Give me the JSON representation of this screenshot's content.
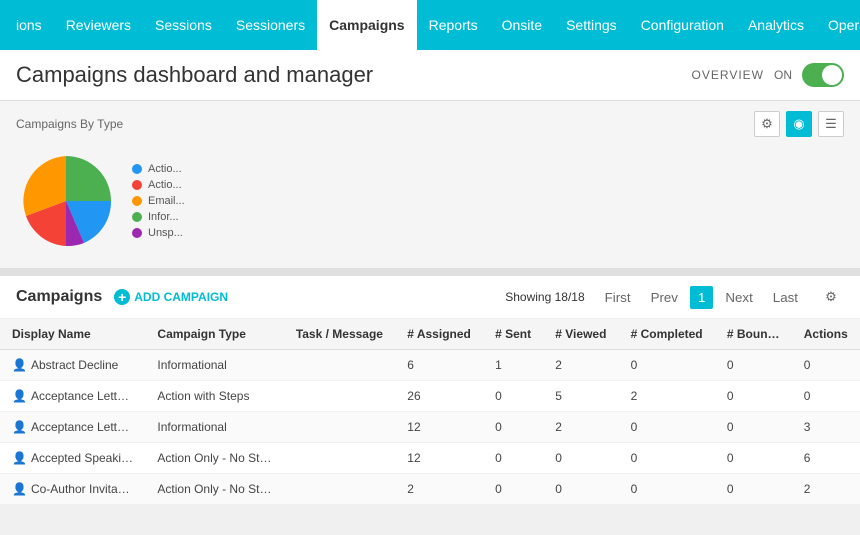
{
  "nav": {
    "items": [
      {
        "label": "ions",
        "active": false
      },
      {
        "label": "Reviewers",
        "active": false
      },
      {
        "label": "Sessions",
        "active": false
      },
      {
        "label": "Sessioners",
        "active": false
      },
      {
        "label": "Campaigns",
        "active": true
      },
      {
        "label": "Reports",
        "active": false
      },
      {
        "label": "Onsite",
        "active": false
      },
      {
        "label": "Settings",
        "active": false
      },
      {
        "label": "Configuration",
        "active": false
      },
      {
        "label": "Analytics",
        "active": false
      },
      {
        "label": "Operation",
        "active": false
      }
    ]
  },
  "header": {
    "title": "Campaigns dashboard and manager",
    "overview_label": "OVERVIEW",
    "on_label": "ON"
  },
  "chart": {
    "title": "Campaigns By Type",
    "legend": [
      {
        "label": "Actio...",
        "color": "#2196f3"
      },
      {
        "label": "Actio...",
        "color": "#f44336"
      },
      {
        "label": "Email...",
        "color": "#ff9800"
      },
      {
        "label": "Infor...",
        "color": "#4caf50"
      },
      {
        "label": "Unsp...",
        "color": "#9c27b0"
      }
    ]
  },
  "campaigns": {
    "title": "Campaigns",
    "add_label": "ADD CAMPAIGN",
    "showing": "Showing 18/18",
    "pagination": {
      "first": "First",
      "prev": "Prev",
      "current": "1",
      "next": "Next",
      "last": "Last"
    },
    "columns": [
      "Display Name",
      "Campaign Type",
      "Task / Message",
      "# Assigned",
      "# Sent",
      "# Viewed",
      "# Completed",
      "# Boun…",
      "Actions"
    ],
    "rows": [
      {
        "name": "Abstract Decline",
        "type": "Informational",
        "task": "",
        "assigned": "6",
        "sent": "1",
        "viewed": "2",
        "completed": "0",
        "bounce": "0",
        "actions": "0"
      },
      {
        "name": "Acceptance Lett…",
        "type": "Action with Steps",
        "task": "",
        "assigned": "26",
        "sent": "0",
        "viewed": "5",
        "completed": "2",
        "bounce": "0",
        "actions": "0"
      },
      {
        "name": "Acceptance Lett…",
        "type": "Informational",
        "task": "",
        "assigned": "12",
        "sent": "0",
        "viewed": "2",
        "completed": "0",
        "bounce": "0",
        "actions": "3"
      },
      {
        "name": "Accepted Speaki…",
        "type": "Action Only - No St…",
        "task": "",
        "assigned": "12",
        "sent": "0",
        "viewed": "0",
        "completed": "0",
        "bounce": "0",
        "actions": "6"
      },
      {
        "name": "Co-Author Invita…",
        "type": "Action Only - No St…",
        "task": "",
        "assigned": "2",
        "sent": "0",
        "viewed": "0",
        "completed": "0",
        "bounce": "0",
        "actions": "2"
      }
    ]
  }
}
